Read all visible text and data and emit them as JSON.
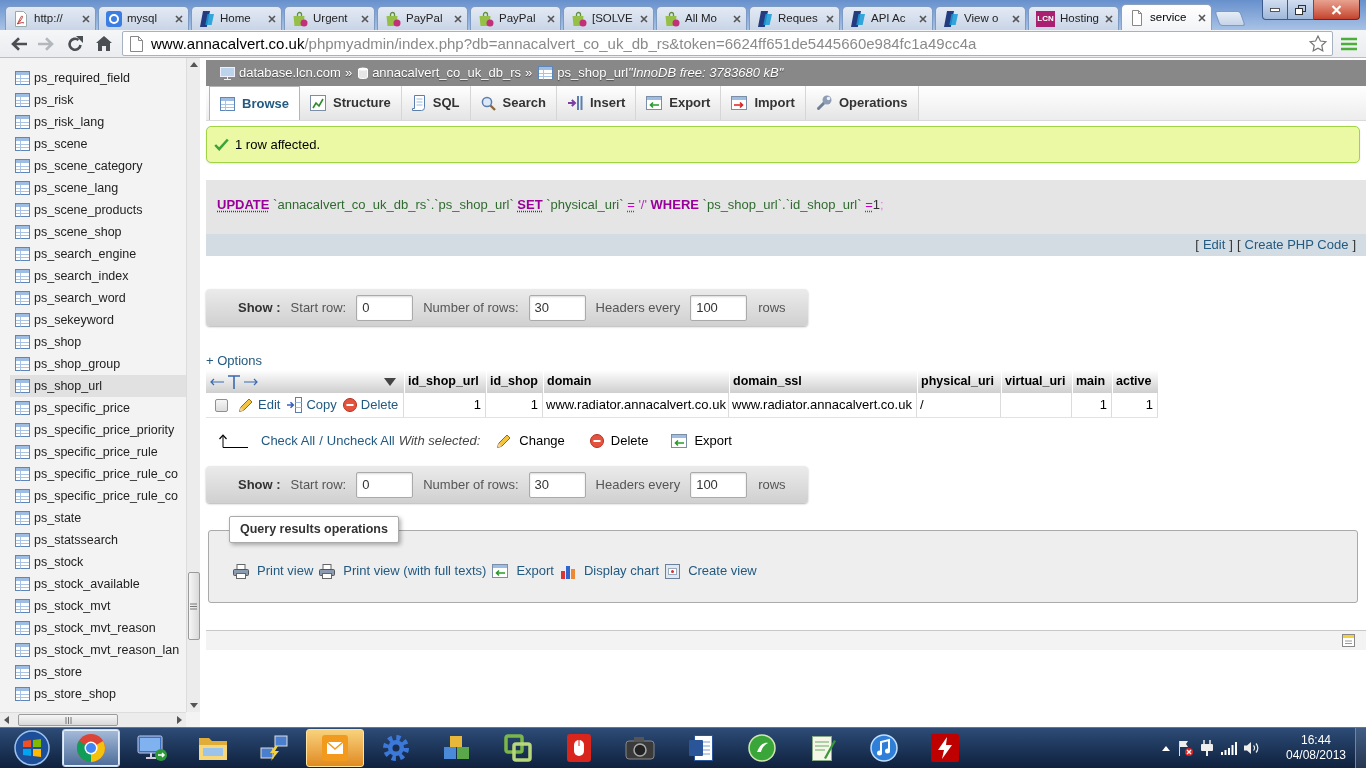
{
  "browser": {
    "tabs": [
      {
        "title": "http://",
        "kind": "pdf",
        "selected": false
      },
      {
        "title": "mysql",
        "kind": "google",
        "selected": false
      },
      {
        "title": "Home",
        "kind": "paypal",
        "selected": false
      },
      {
        "title": "Urgent",
        "kind": "shop",
        "selected": false
      },
      {
        "title": "PayPal",
        "kind": "shop",
        "selected": false
      },
      {
        "title": "PayPal",
        "kind": "shop",
        "selected": false
      },
      {
        "title": "[SOLVE",
        "kind": "shop",
        "selected": false
      },
      {
        "title": "All Mo",
        "kind": "shop",
        "selected": false
      },
      {
        "title": "Reques",
        "kind": "paypal",
        "selected": false
      },
      {
        "title": "API Ac",
        "kind": "paypal",
        "selected": false
      },
      {
        "title": "View o",
        "kind": "paypal",
        "selected": false
      },
      {
        "title": "Hosting",
        "kind": "lcn",
        "logo_text": "LCN",
        "selected": false
      },
      {
        "title": "service",
        "kind": "page",
        "selected": true
      }
    ],
    "nav_buttons": [
      {
        "kind": "back",
        "disabled": false
      },
      {
        "kind": "forward",
        "disabled": true
      },
      {
        "kind": "reload",
        "disabled": false
      },
      {
        "kind": "home",
        "disabled": false
      }
    ],
    "address": {
      "host": "www.annacalvert.co.uk",
      "path": "/phpmyadmin/index.php?db=annacalvert_co_uk_db_rs&token=6624ff651de5445660e984fc1a49cc4a"
    }
  },
  "sidebar": {
    "items": [
      {
        "name": "ps_required_field",
        "selected": false
      },
      {
        "name": "ps_risk",
        "selected": false
      },
      {
        "name": "ps_risk_lang",
        "selected": false
      },
      {
        "name": "ps_scene",
        "selected": false
      },
      {
        "name": "ps_scene_category",
        "selected": false
      },
      {
        "name": "ps_scene_lang",
        "selected": false
      },
      {
        "name": "ps_scene_products",
        "selected": false
      },
      {
        "name": "ps_scene_shop",
        "selected": false
      },
      {
        "name": "ps_search_engine",
        "selected": false
      },
      {
        "name": "ps_search_index",
        "selected": false
      },
      {
        "name": "ps_search_word",
        "selected": false
      },
      {
        "name": "ps_sekeyword",
        "selected": false
      },
      {
        "name": "ps_shop",
        "selected": false
      },
      {
        "name": "ps_shop_group",
        "selected": false
      },
      {
        "name": "ps_shop_url",
        "selected": true
      },
      {
        "name": "ps_specific_price",
        "selected": false
      },
      {
        "name": "ps_specific_price_priority",
        "selected": false
      },
      {
        "name": "ps_specific_price_rule",
        "selected": false
      },
      {
        "name": "ps_specific_price_rule_co",
        "selected": false
      },
      {
        "name": "ps_specific_price_rule_co",
        "selected": false
      },
      {
        "name": "ps_state",
        "selected": false
      },
      {
        "name": "ps_statssearch",
        "selected": false
      },
      {
        "name": "ps_stock",
        "selected": false
      },
      {
        "name": "ps_stock_available",
        "selected": false
      },
      {
        "name": "ps_stock_mvt",
        "selected": false
      },
      {
        "name": "ps_stock_mvt_reason",
        "selected": false
      },
      {
        "name": "ps_stock_mvt_reason_lan",
        "selected": false
      },
      {
        "name": "ps_store",
        "selected": false
      },
      {
        "name": "ps_store_shop",
        "selected": false
      }
    ]
  },
  "breadcrumb": {
    "items": [
      {
        "kind": "server",
        "label": "database.lcn.com",
        "separator": "»"
      },
      {
        "kind": "database",
        "label": "annacalvert_co_uk_db_rs",
        "separator": "»"
      },
      {
        "kind": "table",
        "label": "ps_shop_url"
      }
    ],
    "comment": "\"InnoDB free: 3783680 kB\""
  },
  "tabs": [
    {
      "label": "Browse",
      "kind": "browse",
      "selected": true
    },
    {
      "label": "Structure",
      "kind": "structure",
      "selected": false
    },
    {
      "label": "SQL",
      "kind": "sql",
      "selected": false
    },
    {
      "label": "Search",
      "kind": "search",
      "selected": false
    },
    {
      "label": "Insert",
      "kind": "insert",
      "selected": false
    },
    {
      "label": "Export",
      "kind": "export",
      "selected": false
    },
    {
      "label": "Import",
      "kind": "import",
      "selected": false
    },
    {
      "label": "Operations",
      "kind": "operations",
      "selected": false
    }
  ],
  "message": {
    "text": "1 row affected."
  },
  "sql": {
    "tokens": [
      {
        "text": "UPDATE",
        "kind": "keyword",
        "linked": true
      },
      {
        "text": " `annacalvert_co_uk_db_rs`.`ps_shop_url` ",
        "kind": "identifier",
        "linked": false
      },
      {
        "text": "SET",
        "kind": "keyword",
        "linked": true
      },
      {
        "text": " `physical_uri` ",
        "kind": "identifier",
        "linked": false
      },
      {
        "text": "=",
        "kind": "operator",
        "linked": true
      },
      {
        "text": " '/' ",
        "kind": "string",
        "linked": false
      },
      {
        "text": "WHERE",
        "kind": "keyword",
        "linked": false
      },
      {
        "text": " `ps_shop_url`.`id_shop_url` ",
        "kind": "identifier",
        "linked": false
      },
      {
        "text": "=",
        "kind": "operator",
        "linked": true
      },
      {
        "text": "1",
        "kind": "number",
        "linked": false
      },
      {
        "text": ";",
        "kind": "punctuation",
        "linked": false
      }
    ],
    "links": [
      {
        "before": "[",
        "label": "Edit",
        "after": "]"
      },
      {
        "before": "[",
        "label": "Create PHP Code",
        "after": "]"
      }
    ]
  },
  "show_bar_top": {
    "label": "Show :",
    "fields": [
      {
        "label": "Start row:",
        "value": "0"
      },
      {
        "label": "Number of rows:",
        "value": "30"
      },
      {
        "label": "Headers every",
        "value": "100"
      }
    ],
    "suffix": "rows"
  },
  "options_link": "+ Options",
  "results_table": {
    "columns": [
      "id_shop_url",
      "id_shop",
      "domain",
      "domain_ssl",
      "physical_uri",
      "virtual_uri",
      "main",
      "active"
    ],
    "rows": [
      {
        "checked": false,
        "actions": [
          {
            "kind": "edit",
            "label": "Edit"
          },
          {
            "kind": "copy",
            "label": "Copy"
          },
          {
            "kind": "delete",
            "label": "Delete"
          }
        ],
        "cells": [
          {
            "text": "1",
            "numeric": true
          },
          {
            "text": "1",
            "numeric": true
          },
          {
            "text": "www.radiator.annacalvert.co.uk",
            "numeric": false
          },
          {
            "text": "www.radiator.annacalvert.co.uk",
            "numeric": false
          },
          {
            "text": "/",
            "numeric": false
          },
          {},
          {
            "text": "1",
            "numeric": true
          },
          {
            "text": "1",
            "numeric": true
          }
        ]
      }
    ]
  },
  "bulk_actions": {
    "check_all": "Check All",
    "separator": "/",
    "uncheck_all": "Uncheck All",
    "with_selected": "With selected:",
    "actions": [
      {
        "kind": "change",
        "label": "Change"
      },
      {
        "kind": "delete",
        "label": "Delete"
      },
      {
        "kind": "export",
        "label": "Export"
      }
    ]
  },
  "show_bar_bottom": {
    "label": "Show :",
    "fields": [
      {
        "label": "Start row:",
        "value": "0"
      },
      {
        "label": "Number of rows:",
        "value": "30"
      },
      {
        "label": "Headers every",
        "value": "100"
      }
    ],
    "suffix": "rows"
  },
  "query_results_operations": {
    "legend": "Query results operations",
    "actions": [
      {
        "kind": "print",
        "label": "Print view"
      },
      {
        "kind": "print",
        "label": "Print view (with full texts)"
      },
      {
        "kind": "export",
        "label": "Export"
      },
      {
        "kind": "chart",
        "label": "Display chart"
      },
      {
        "kind": "view",
        "label": "Create view"
      }
    ]
  },
  "taskbar": {
    "apps": [
      {
        "kind": "browser",
        "active": true,
        "flashing": false
      },
      {
        "kind": "remote",
        "active": false,
        "flashing": false
      },
      {
        "kind": "explorer",
        "active": false,
        "flashing": false
      },
      {
        "kind": "network",
        "active": false,
        "flashing": false
      },
      {
        "kind": "mail",
        "active": false,
        "flashing": true
      },
      {
        "kind": "gear",
        "active": false,
        "flashing": false
      },
      {
        "kind": "boxes",
        "active": false,
        "flashing": false
      },
      {
        "kind": "vm",
        "active": false,
        "flashing": false
      },
      {
        "kind": "mouse",
        "active": false,
        "flashing": false
      },
      {
        "kind": "camera",
        "active": false,
        "flashing": false
      },
      {
        "kind": "word",
        "active": false,
        "flashing": false
      },
      {
        "kind": "green",
        "active": false,
        "flashing": false
      },
      {
        "kind": "notepad",
        "active": false,
        "flashing": false
      },
      {
        "kind": "music",
        "active": false,
        "flashing": false
      },
      {
        "kind": "ftp",
        "active": false,
        "flashing": false
      }
    ],
    "clock": {
      "time": "16:44",
      "date": "04/08/2013"
    }
  }
}
